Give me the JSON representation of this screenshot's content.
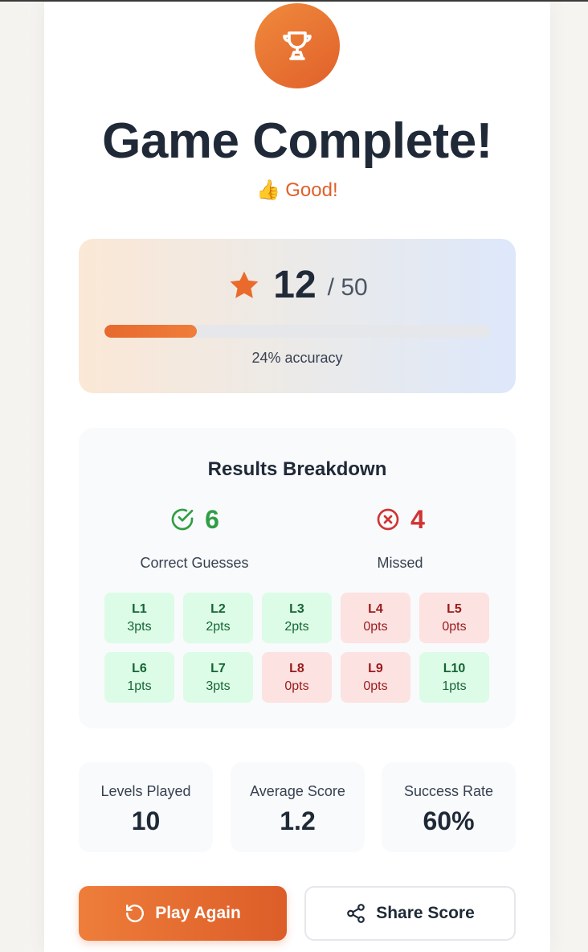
{
  "header": {
    "title": "Game Complete!",
    "rating_emoji": "👍",
    "rating_text": "Good!"
  },
  "score": {
    "value": "12",
    "max": "/ 50",
    "progress_fraction": 0.24,
    "accuracy_text": "24% accuracy"
  },
  "results": {
    "title": "Results Breakdown",
    "correct_count": "6",
    "correct_label": "Correct Guesses",
    "missed_count": "4",
    "missed_label": "Missed",
    "levels": [
      {
        "name": "L1",
        "points": "3pts",
        "status": "correct"
      },
      {
        "name": "L2",
        "points": "2pts",
        "status": "correct"
      },
      {
        "name": "L3",
        "points": "2pts",
        "status": "correct"
      },
      {
        "name": "L4",
        "points": "0pts",
        "status": "missed"
      },
      {
        "name": "L5",
        "points": "0pts",
        "status": "missed"
      },
      {
        "name": "L6",
        "points": "1pts",
        "status": "correct"
      },
      {
        "name": "L7",
        "points": "3pts",
        "status": "correct"
      },
      {
        "name": "L8",
        "points": "0pts",
        "status": "missed"
      },
      {
        "name": "L9",
        "points": "0pts",
        "status": "missed"
      },
      {
        "name": "L10",
        "points": "1pts",
        "status": "correct"
      }
    ]
  },
  "stats": [
    {
      "label": "Levels Played",
      "value": "10"
    },
    {
      "label": "Average Score",
      "value": "1.2"
    },
    {
      "label": "Success Rate",
      "value": "60%"
    }
  ],
  "buttons": {
    "play_again": "Play Again",
    "share_score": "Share Score"
  },
  "icons": {
    "trophy": "trophy-icon",
    "star": "star-icon",
    "check": "check-circle-icon",
    "cross": "x-circle-icon",
    "replay": "rotate-ccw-icon",
    "share": "share-icon"
  },
  "colors": {
    "accent": "#e0602a",
    "correct": "#2f9e44",
    "missed": "#d03434"
  }
}
